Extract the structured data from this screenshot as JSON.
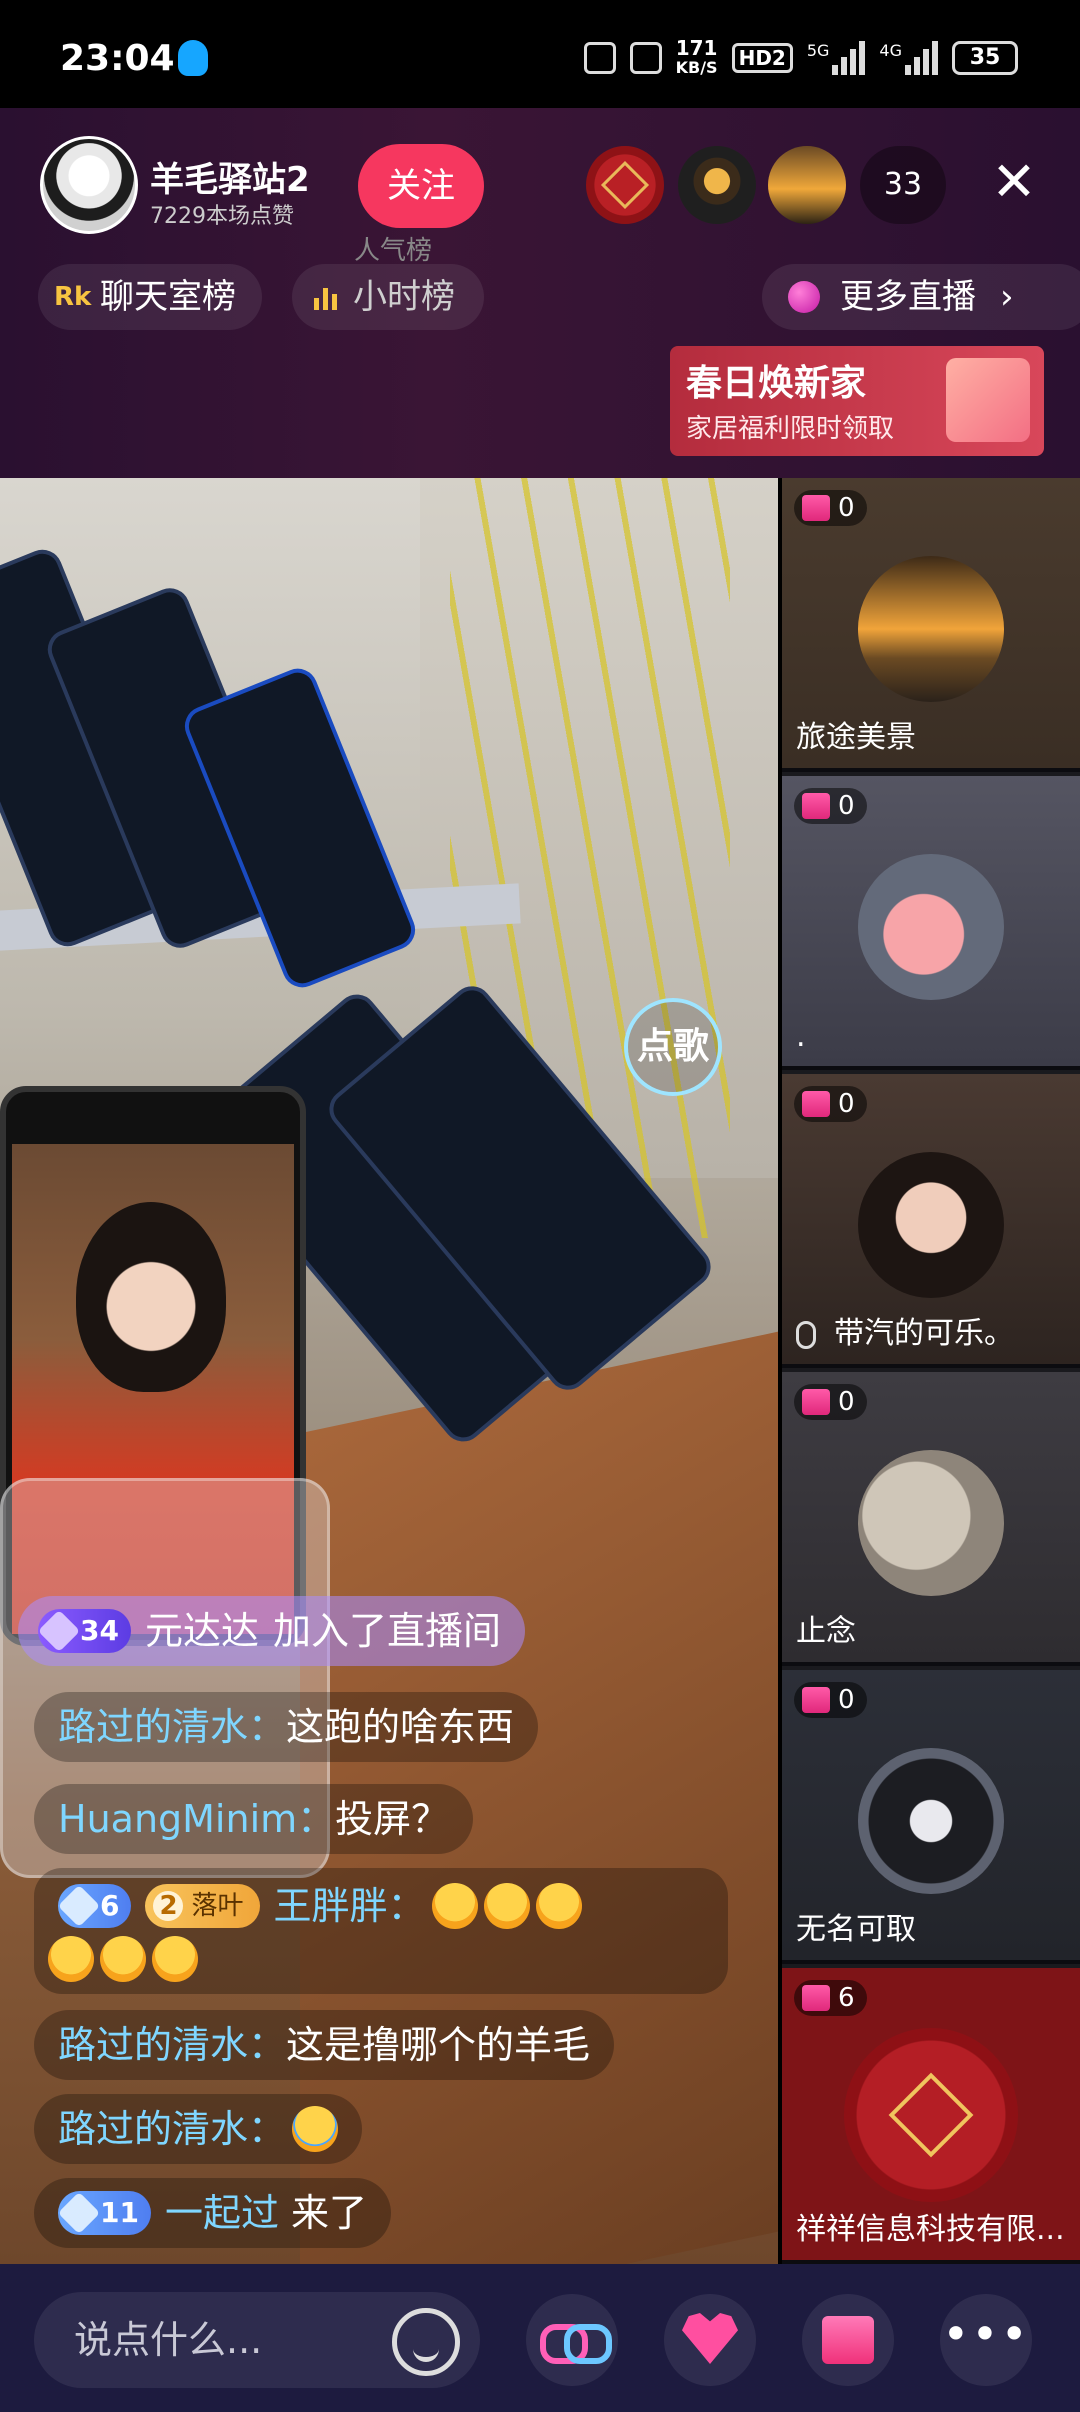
{
  "status_bar": {
    "time": "23:04",
    "speed": "171",
    "speed_unit": "KB/S",
    "hd": "HD2",
    "net1": "5G",
    "net2": "4G",
    "battery": "35"
  },
  "host": {
    "name": "羊毛驿站2",
    "likes": "7229本场点赞",
    "follow_label": "关注",
    "viewer_count": "33",
    "close_label": "✕"
  },
  "chips": {
    "chat_rank": "聊天室榜",
    "hour_rank_top": "人气榜",
    "hour_rank": "小时榜",
    "more_live": "更多直播"
  },
  "banner": {
    "title": "春日焕新家",
    "subtitle": "家居福利限时领取"
  },
  "video": {
    "song_button": "点歌"
  },
  "chat": {
    "join": {
      "level": "34",
      "user": "元达达",
      "text": "加入了直播间"
    },
    "messages": [
      {
        "user": "路过的清水：",
        "text": "这跑的啥东西"
      },
      {
        "user": "HuangMinim：",
        "text": "投屏？"
      },
      {
        "level": "6",
        "fan_level": "2",
        "fan_name": "落叶",
        "user": "王胖胖：",
        "emoji_label": "互粉"
      },
      {
        "user": "路过的清水：",
        "text": "这是撸哪个的羊毛"
      },
      {
        "user": "路过的清水：",
        "text": ""
      },
      {
        "level": "11",
        "user": "一起过",
        "text": "来了"
      }
    ]
  },
  "sidebar": {
    "cards": [
      {
        "gifts": "0",
        "label": "旅途美景"
      },
      {
        "gifts": "0",
        "label": "."
      },
      {
        "gifts": "0",
        "label": "带汽的可乐。"
      },
      {
        "gifts": "0",
        "label": "止念"
      },
      {
        "gifts": "0",
        "label": "无名可取"
      },
      {
        "gifts": "6",
        "label": "祥祥信息科技有限..."
      }
    ]
  },
  "bottom": {
    "input_placeholder": "说点什么..."
  }
}
